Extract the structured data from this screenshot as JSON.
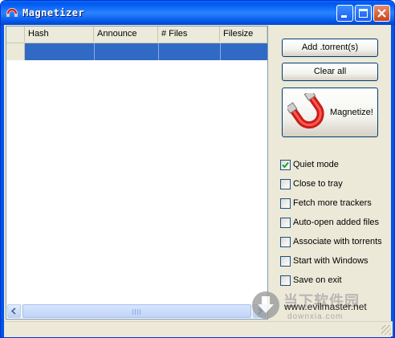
{
  "window": {
    "title": "Magnetizer"
  },
  "title_buttons": {
    "minimize": "minimize-icon",
    "maximize": "maximize-icon",
    "close": "close-icon"
  },
  "table": {
    "columns": [
      "Hash",
      "Announce",
      "# Files",
      "Filesize"
    ],
    "selected_row": [
      "",
      "",
      "",
      ""
    ]
  },
  "buttons": {
    "add_torrents": "Add .torrent(s)",
    "clear_all": "Clear all",
    "magnetize": "Magnetize!"
  },
  "options": [
    {
      "label": "Quiet mode",
      "checked": true
    },
    {
      "label": "Close to tray",
      "checked": false
    },
    {
      "label": "Fetch more trackers",
      "checked": false
    },
    {
      "label": "Auto-open added files",
      "checked": false
    },
    {
      "label": "Associate with torrents",
      "checked": false
    },
    {
      "label": "Start with Windows",
      "checked": false
    },
    {
      "label": "Save on exit",
      "checked": false
    }
  ],
  "footer": {
    "site": "www.evilmaster.net"
  },
  "watermark": {
    "main": "当下软件园",
    "sub": "downxia.com"
  },
  "colors": {
    "titlebar": "#0058ee",
    "selection": "#316ac5",
    "dialog": "#ece9d8"
  }
}
